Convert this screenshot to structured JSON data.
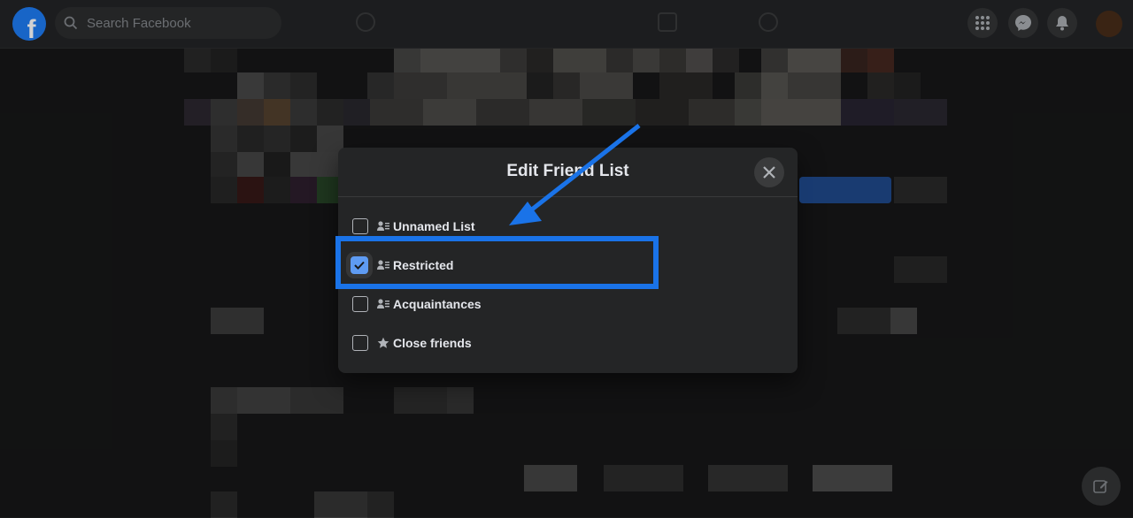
{
  "nav": {
    "logo_letter": "f",
    "search_placeholder": "Search Facebook",
    "icons": [
      "menu-grid-icon",
      "messenger-icon",
      "notifications-bell-icon"
    ]
  },
  "dialog": {
    "title": "Edit Friend List",
    "lists": [
      {
        "label": "Unnamed List",
        "checked": false,
        "icon": "friend-list-icon"
      },
      {
        "label": "Restricted",
        "checked": true,
        "icon": "friend-list-icon"
      },
      {
        "label": "Acquaintances",
        "checked": false,
        "icon": "friend-list-icon"
      },
      {
        "label": "Close friends",
        "checked": false,
        "icon": "star-icon"
      }
    ]
  },
  "colors": {
    "accent": "#1a73e8",
    "checkbox_checked": "#5e9bf2",
    "dialog_bg": "#242526",
    "page_bg": "#18191a"
  }
}
